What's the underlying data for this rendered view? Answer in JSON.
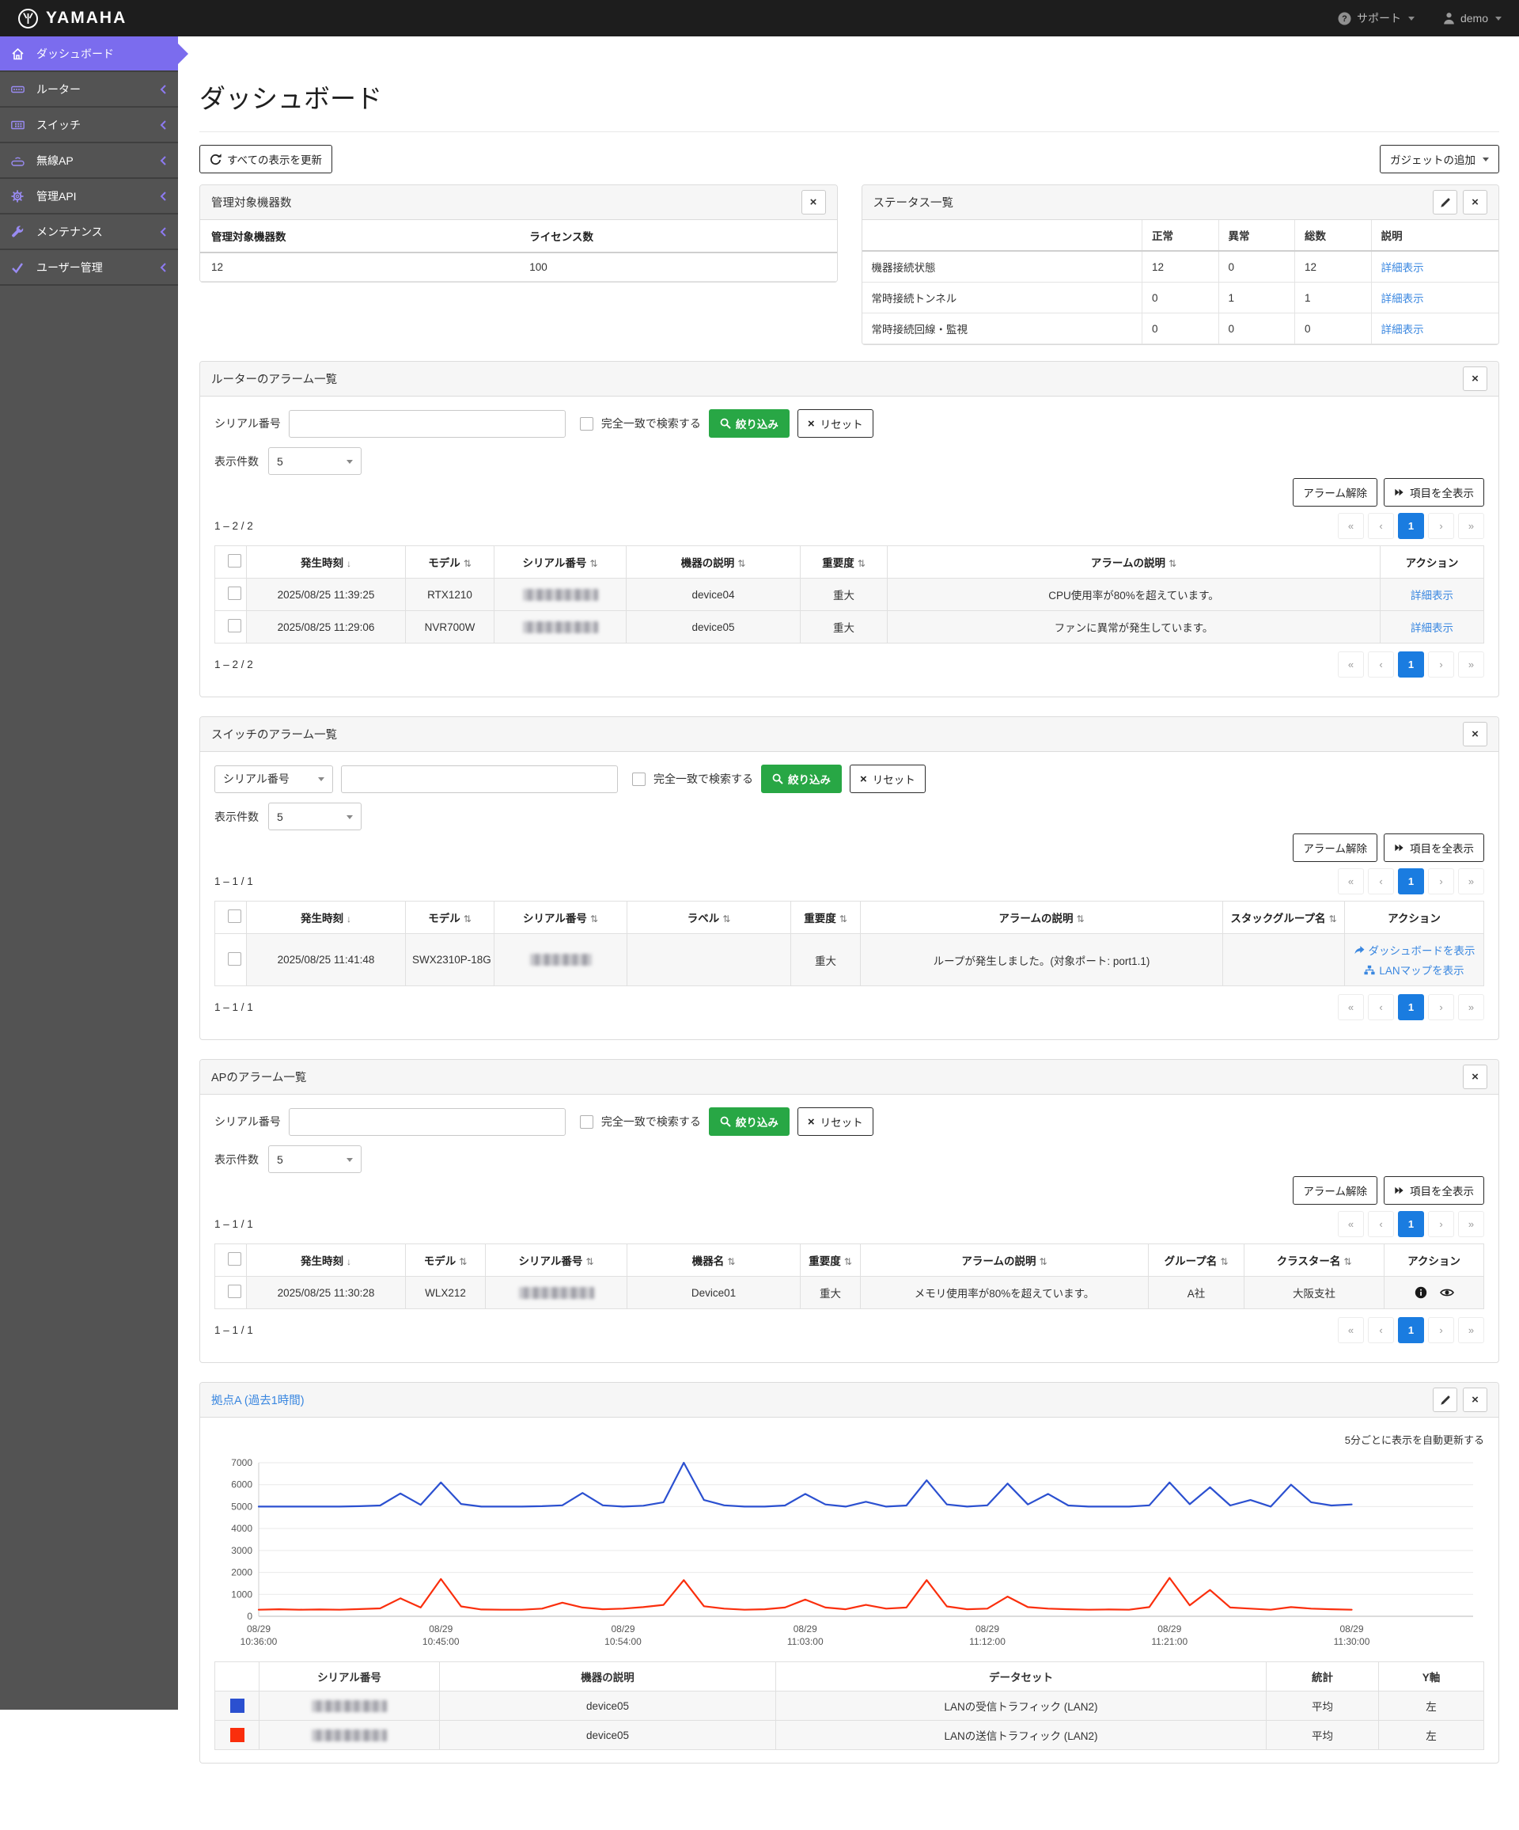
{
  "topbar": {
    "brand": "YAMAHA",
    "support": "サポート",
    "user": "demo"
  },
  "sidebar": {
    "items": [
      {
        "label": "ダッシュボード"
      },
      {
        "label": "ルーター"
      },
      {
        "label": "スイッチ"
      },
      {
        "label": "無線AP"
      },
      {
        "label": "管理API"
      },
      {
        "label": "メンテナンス"
      },
      {
        "label": "ユーザー管理"
      }
    ]
  },
  "page": {
    "title": "ダッシュボード",
    "refresh_all": "すべての表示を更新",
    "add_gadget": "ガジェットの追加"
  },
  "icons": {
    "sort_both": "⇅",
    "sort_desc": "↓",
    "close": "×"
  },
  "colors": {
    "accent_purple": "#7b6cee",
    "link_blue": "#3a87e0",
    "button_green": "#28a745",
    "pager_active": "#1a7ce0"
  },
  "pagination": {
    "first": "«",
    "prev": "‹",
    "page": "1",
    "next": "›",
    "last": "»"
  },
  "device_count": {
    "title": "管理対象機器数",
    "columns": [
      "管理対象機器数",
      "ライセンス数"
    ],
    "values": [
      "12",
      "100"
    ]
  },
  "status_list": {
    "title": "ステータス一覧",
    "columns": [
      "正常",
      "異常",
      "総数",
      "説明"
    ],
    "rows": [
      {
        "name": "機器接続状態",
        "normal": "12",
        "abnormal": "0",
        "total": "12",
        "link": "詳細表示"
      },
      {
        "name": "常時接続トンネル",
        "normal": "0",
        "abnormal": "1",
        "total": "1",
        "link": "詳細表示"
      },
      {
        "name": "常時接続回線・監視",
        "normal": "0",
        "abnormal": "0",
        "total": "0",
        "link": "詳細表示"
      }
    ]
  },
  "router_alarms": {
    "title": "ルーターのアラーム一覧",
    "serial_label": "シリアル番号",
    "exact_label": "完全一致で検索する",
    "filter_btn": "絞り込み",
    "reset_btn": "リセット",
    "page_size_label": "表示件数",
    "page_size": "5",
    "range": "1 – 2 / 2",
    "clear_btn": "アラーム解除",
    "show_all_btn": "項目を全表示",
    "columns": [
      "発生時刻",
      "モデル",
      "シリアル番号",
      "機器の説明",
      "重要度",
      "アラームの説明",
      "アクション"
    ],
    "rows": [
      {
        "time": "2025/08/25 11:39:25",
        "model": "RTX1210",
        "desc": "device04",
        "severity": "重大",
        "alarm": "CPU使用率が80%を超えています。",
        "action": "詳細表示"
      },
      {
        "time": "2025/08/25 11:29:06",
        "model": "NVR700W",
        "desc": "device05",
        "severity": "重大",
        "alarm": "ファンに異常が発生しています。",
        "action": "詳細表示"
      }
    ]
  },
  "switch_alarms": {
    "title": "スイッチのアラーム一覧",
    "search_field": "シリアル番号",
    "exact_label": "完全一致で検索する",
    "filter_btn": "絞り込み",
    "reset_btn": "リセット",
    "page_size_label": "表示件数",
    "page_size": "5",
    "range": "1 – 1 / 1",
    "clear_btn": "アラーム解除",
    "show_all_btn": "項目を全表示",
    "columns": [
      "発生時刻",
      "モデル",
      "シリアル番号",
      "ラベル",
      "重要度",
      "アラームの説明",
      "スタックグループ名",
      "アクション"
    ],
    "rows": [
      {
        "time": "2025/08/25 11:41:48",
        "model": "SWX2310P-18G",
        "label": "",
        "severity": "重大",
        "alarm": "ループが発生しました。(対象ポート: port1.1)",
        "stack": "",
        "action_dashboard": "ダッシュボードを表示",
        "action_lanmap": "LANマップを表示"
      }
    ]
  },
  "ap_alarms": {
    "title": "APのアラーム一覧",
    "serial_label": "シリアル番号",
    "exact_label": "完全一致で検索する",
    "filter_btn": "絞り込み",
    "reset_btn": "リセット",
    "page_size_label": "表示件数",
    "page_size": "5",
    "range": "1 – 1 / 1",
    "clear_btn": "アラーム解除",
    "show_all_btn": "項目を全表示",
    "columns": [
      "発生時刻",
      "モデル",
      "シリアル番号",
      "機器名",
      "重要度",
      "アラームの説明",
      "グループ名",
      "クラスター名",
      "アクション"
    ],
    "rows": [
      {
        "time": "2025/08/25 11:30:28",
        "model": "WLX212",
        "name": "Device01",
        "severity": "重大",
        "alarm": "メモリ使用率が80%を超えています。",
        "group": "A社",
        "cluster": "大阪支社"
      }
    ]
  },
  "site_widget": {
    "title": "拠点A (過去1時間)",
    "auto_refresh": "5分ごとに表示を自動更新する",
    "legend_columns": [
      "シリアル番号",
      "機器の説明",
      "データセット",
      "統計",
      "Y軸"
    ],
    "legend_rows": [
      {
        "color": "#2b50d0",
        "device": "device05",
        "dataset": "LANの受信トラフィック (LAN2)",
        "stat": "平均",
        "axis": "左"
      },
      {
        "color": "#fa2e0c",
        "device": "device05",
        "dataset": "LANの送信トラフィック (LAN2)",
        "stat": "平均",
        "axis": "左"
      }
    ]
  },
  "chart_data": {
    "type": "line",
    "title": "拠点A (過去1時間)",
    "xlabel": "",
    "ylabel": "",
    "ylim": [
      0,
      7000
    ],
    "y_ticks": [
      0,
      1000,
      2000,
      3000,
      4000,
      5000,
      6000,
      7000
    ],
    "grid": "horizontal",
    "legend_position": "table-below",
    "x_domain_minutes": 60,
    "x_tick_step_minutes": 9,
    "sample_interval_minutes": 1,
    "x_tick_dates": [
      "08/29",
      "08/29",
      "08/29",
      "08/29",
      "08/29",
      "08/29",
      "08/29"
    ],
    "x_tick_times": [
      "10:36:00",
      "10:45:00",
      "10:54:00",
      "11:03:00",
      "11:12:00",
      "11:21:00",
      "11:30:00"
    ],
    "series": [
      {
        "name": "LANの受信トラフィック (LAN2)",
        "color": "#2b50d0",
        "values": [
          5000,
          5000,
          5000,
          5000,
          5000,
          5020,
          5050,
          5600,
          5080,
          6100,
          5120,
          5000,
          5000,
          5000,
          5020,
          5060,
          5620,
          5060,
          5000,
          5040,
          5200,
          7000,
          5300,
          5060,
          5000,
          5000,
          5050,
          5580,
          5100,
          5000,
          5220,
          5000,
          5050,
          6200,
          5100,
          5000,
          5060,
          6050,
          5100,
          5580,
          5050,
          5000,
          5000,
          5000,
          5060,
          6100,
          5110,
          5880,
          5050,
          5300,
          5000,
          6000,
          5200,
          5050,
          5100
        ]
      },
      {
        "name": "LANの送信トラフィック (LAN2)",
        "color": "#fa2e0c",
        "values": [
          300,
          320,
          300,
          310,
          300,
          330,
          360,
          820,
          400,
          1700,
          450,
          310,
          300,
          300,
          350,
          620,
          400,
          320,
          350,
          420,
          520,
          1650,
          460,
          350,
          300,
          320,
          400,
          760,
          400,
          320,
          520,
          350,
          400,
          1650,
          450,
          320,
          350,
          900,
          420,
          350,
          320,
          300,
          310,
          300,
          420,
          1750,
          500,
          1200,
          400,
          350,
          300,
          420,
          350,
          320,
          300
        ]
      }
    ]
  }
}
